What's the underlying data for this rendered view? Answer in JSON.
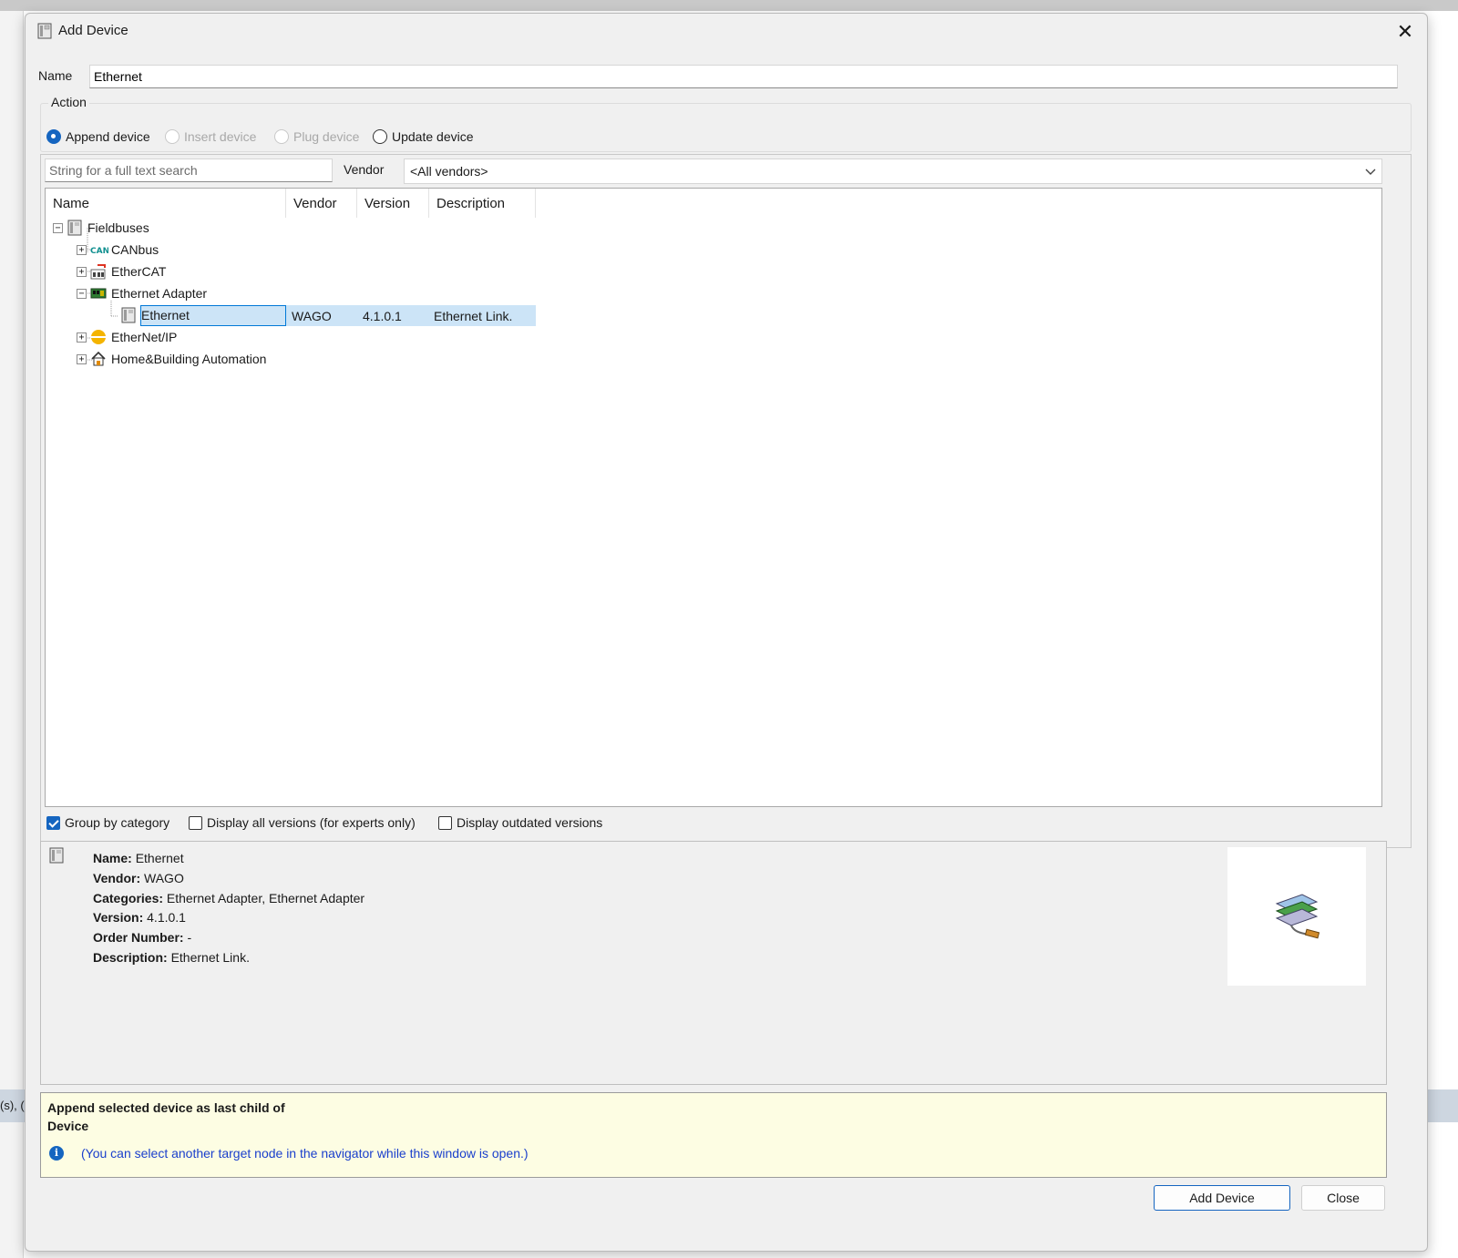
{
  "background": {
    "status_fragment": "(s), ("
  },
  "dialog": {
    "title": "Add Device",
    "close_glyph": "✕"
  },
  "name_field": {
    "label": "Name",
    "value": "Ethernet"
  },
  "action": {
    "legend": "Action",
    "options": [
      {
        "label": "Append device",
        "checked": true,
        "enabled": true
      },
      {
        "label": "Insert device",
        "checked": false,
        "enabled": false
      },
      {
        "label": "Plug device",
        "checked": false,
        "enabled": false
      },
      {
        "label": "Update device",
        "checked": false,
        "enabled": true
      }
    ]
  },
  "search": {
    "placeholder": "String for a full text search"
  },
  "vendor": {
    "label": "Vendor",
    "selected": "<All vendors>"
  },
  "tree": {
    "columns": [
      "Name",
      "Vendor",
      "Version",
      "Description"
    ],
    "nodes": [
      {
        "label": "Fieldbuses",
        "icon": "device-icon",
        "expander": "−"
      },
      {
        "label": "CANbus",
        "icon": "can-icon",
        "expander": "+"
      },
      {
        "label": "EtherCAT",
        "icon": "ethercat-icon",
        "expander": "+"
      },
      {
        "label": "Ethernet Adapter",
        "icon": "network-card-icon",
        "expander": "−"
      },
      {
        "label": "Ethernet",
        "icon": "device-icon",
        "vendor": "WAGO",
        "version": "4.1.0.1",
        "description": "Ethernet Link."
      },
      {
        "label": "EtherNet/IP",
        "icon": "ethernet-ip-icon",
        "expander": "+"
      },
      {
        "label": "Home&Building Automation",
        "icon": "house-icon",
        "expander": "+"
      }
    ]
  },
  "options": {
    "group_by_category": {
      "label": "Group by category",
      "checked": true
    },
    "display_all_versions": {
      "label": "Display all versions (for experts only)",
      "checked": false
    },
    "display_outdated": {
      "label": "Display outdated versions",
      "checked": false
    }
  },
  "info": {
    "name_label": "Name:",
    "name_value": "Ethernet",
    "vendor_label": "Vendor:",
    "vendor_value": "WAGO",
    "categories_label": "Categories:",
    "categories_value": "Ethernet Adapter, Ethernet Adapter",
    "version_label": "Version:",
    "version_value": "4.1.0.1",
    "order_label": "Order Number:",
    "order_value": "-",
    "description_label": "Description:",
    "description_value": "Ethernet Link."
  },
  "hint": {
    "line1": "Append selected device as last child of",
    "line2": "Device",
    "info_glyph": "i",
    "note": "(You can select another target node in the navigator while this window is open.)"
  },
  "buttons": {
    "add_device": "Add Device",
    "close": "Close"
  },
  "colors": {
    "accent": "#1565c0",
    "selection": "#cce4f7",
    "hint_bg": "#fdfde3",
    "hint_text": "#1a3fcc"
  }
}
